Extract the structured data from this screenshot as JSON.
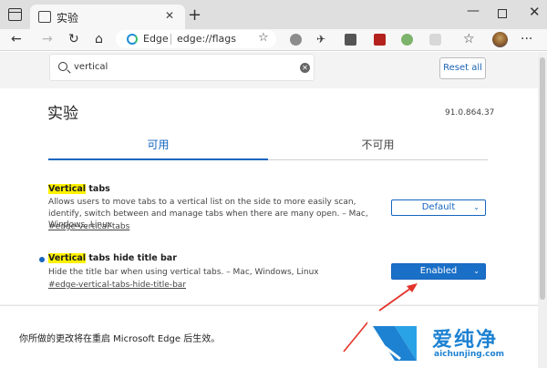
{
  "tab": {
    "title": "实验"
  },
  "address_bar": {
    "brand": "Edge",
    "url": "edge://flags"
  },
  "search": {
    "value": "vertical"
  },
  "toolbar": {
    "reset_label": "Reset all"
  },
  "page": {
    "heading": "实验",
    "version": "91.0.864.37"
  },
  "tabs": {
    "available": "可用",
    "unavailable": "不可用"
  },
  "flags": [
    {
      "title_highlight": "Vertical",
      "title_rest": " tabs",
      "description": "Allows users to move tabs to a vertical list on the side to more easily scan, identify, switch between and manage tabs when there are many open. – Mac, Windows, Linux",
      "link": "#edge-vertical-tabs",
      "value": "Default",
      "modified": false
    },
    {
      "title_highlight": "Vertical",
      "title_rest": " tabs hide title bar",
      "description": "Hide the title bar when using vertical tabs. – Mac, Windows, Linux",
      "link": "#edge-vertical-tabs-hide-title-bar",
      "value": "Enabled",
      "modified": true
    }
  ],
  "restart": {
    "message": "你所做的更改将在重启 Microsoft Edge 后生效。"
  },
  "watermark": {
    "name": "爱纯净",
    "url": "aichunjing.com"
  },
  "colors": {
    "accent": "#1565c0",
    "highlight": "#fff200",
    "annotation_arrow": "#e3332a"
  },
  "icons": [
    "back-icon",
    "forward-icon",
    "refresh-icon",
    "home-icon",
    "favorite-icon",
    "collections-icon",
    "profile-icon",
    "more-icon"
  ]
}
